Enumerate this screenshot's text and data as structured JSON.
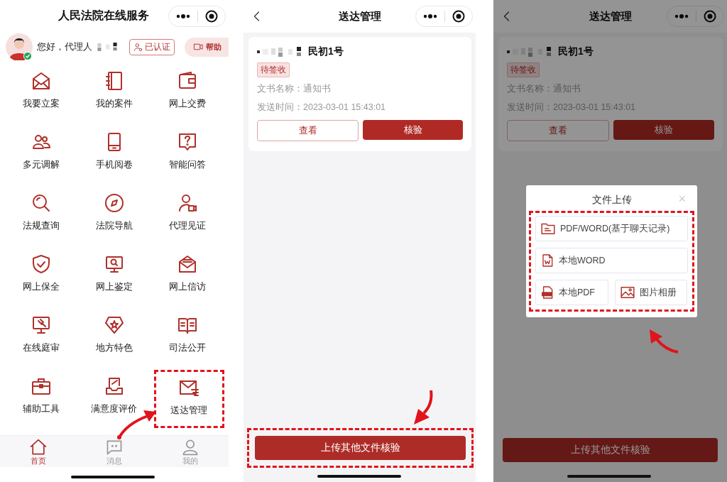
{
  "home": {
    "title": "人民法院在线服务",
    "greeting": "您好，代理人",
    "verified_badge": "已认证",
    "help_button": "帮助",
    "services": [
      {
        "label": "我要立案",
        "highlighted": false
      },
      {
        "label": "我的案件",
        "highlighted": false
      },
      {
        "label": "网上交费",
        "highlighted": false
      },
      {
        "label": "多元调解",
        "highlighted": false
      },
      {
        "label": "手机阅卷",
        "highlighted": false
      },
      {
        "label": "智能问答",
        "highlighted": false
      },
      {
        "label": "法规查询",
        "highlighted": false
      },
      {
        "label": "法院导航",
        "highlighted": false
      },
      {
        "label": "代理见证",
        "highlighted": false
      },
      {
        "label": "网上保全",
        "highlighted": false
      },
      {
        "label": "网上鉴定",
        "highlighted": false
      },
      {
        "label": "网上信访",
        "highlighted": false
      },
      {
        "label": "在线庭审",
        "highlighted": false
      },
      {
        "label": "地方特色",
        "highlighted": false
      },
      {
        "label": "司法公开",
        "highlighted": false
      },
      {
        "label": "辅助工具",
        "highlighted": false
      },
      {
        "label": "满意度评价",
        "highlighted": false
      },
      {
        "label": "送达管理",
        "highlighted": true
      }
    ],
    "tabbar": [
      {
        "label": "首页",
        "selected": true
      },
      {
        "label": "消息",
        "selected": false
      },
      {
        "label": "我的",
        "selected": false
      }
    ]
  },
  "delivery": {
    "title": "送达管理",
    "case": {
      "number": "民初1号",
      "status": "待签收",
      "doc_label": "文书名称：",
      "doc_name": "通知书",
      "time_label": "发送时间：",
      "time": "2023-03-01 15:43:01",
      "view_button": "查看",
      "verify_button": "核验"
    },
    "bottom_button": {
      "label": "上传其他文件核验",
      "highlighted": true
    }
  },
  "upload": {
    "title": "送达管理",
    "case": {
      "number": "民初1号",
      "status": "待签收",
      "doc_label": "文书名称：",
      "doc_name": "通知书",
      "time_label": "发送时间：",
      "time": "2023-03-01 15:43:01",
      "view_button": "查看",
      "verify_button": "核验"
    },
    "bottom_button": {
      "label": "上传其他文件核验",
      "highlighted": false
    },
    "dialog": {
      "title": "文件上传",
      "close": "×",
      "highlighted": true,
      "options": [
        {
          "label": "PDF/WORD(基于聊天记录)",
          "kind": "chat"
        },
        {
          "label": "本地WORD",
          "kind": "word"
        },
        {
          "label": "本地PDF",
          "kind": "pdf"
        },
        {
          "label": "图片相册",
          "kind": "image"
        }
      ]
    }
  }
}
